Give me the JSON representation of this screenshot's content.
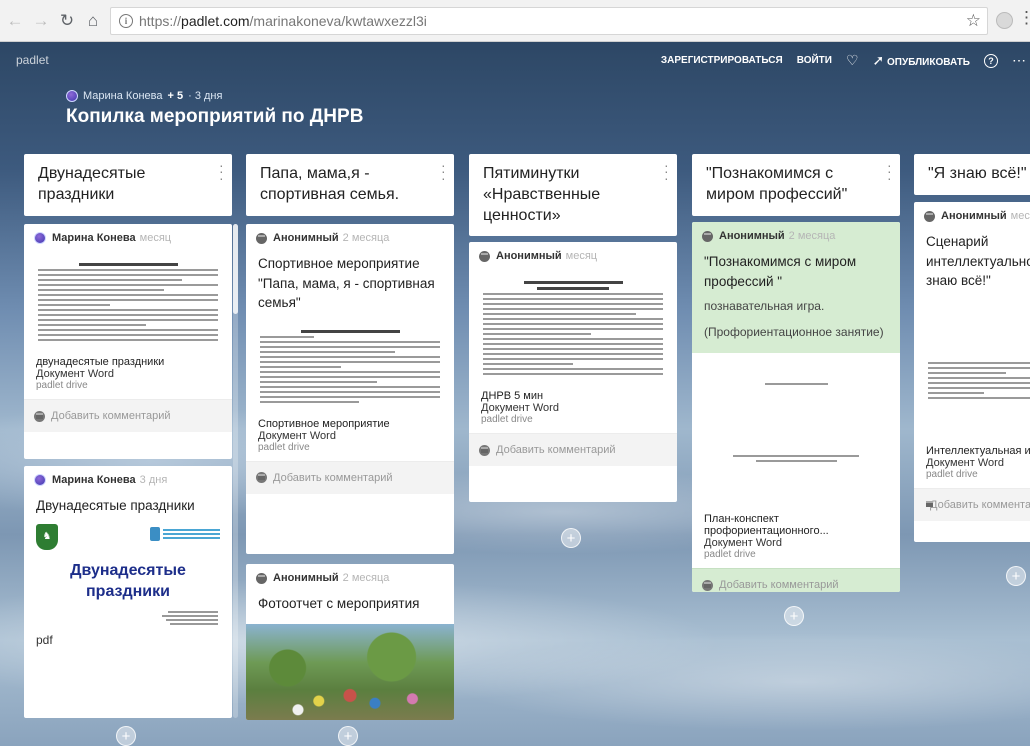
{
  "browser": {
    "url_scheme": "https://",
    "url_host": "padlet.com",
    "url_path": "/marinakoneva/kwtawxezzl3i"
  },
  "app": {
    "logo": "padlet",
    "actions": {
      "signup": "ЗАРЕГИСТРИРОВАТЬСЯ",
      "login": "ВОЙТИ",
      "publish": "ОПУБЛИКОВАТЬ"
    }
  },
  "board": {
    "author": "Марина Конева",
    "contributors": "+ 5",
    "age": "· 3 дня",
    "title": "Копилка мероприятий по ДНРВ"
  },
  "columns": [
    {
      "title": "Двунадесятые праздники",
      "cards": [
        {
          "author": "Марина Конева",
          "when": "месяц",
          "caption": "двунадесятые праздники",
          "type": "Документ Word",
          "source": "padlet drive",
          "comment": "Добавить комментарий"
        },
        {
          "author": "Марина Конева",
          "when": "3 дня",
          "title": "Двунадесятые праздники",
          "big_title": "Двунадесятые праздники",
          "type": "pdf"
        }
      ]
    },
    {
      "title": "Папа, мама,я - спортивная семья.",
      "cards": [
        {
          "author": "Анонимный",
          "when": "2 месяца",
          "title": "Спортивное мероприятие \"Папа, мама, я - спортивная семья\"",
          "caption": "Спортивное мероприятие",
          "type": "Документ Word",
          "source": "padlet drive",
          "comment": "Добавить комментарий"
        },
        {
          "author": "Анонимный",
          "when": "2 месяца",
          "title": "Фотоотчет с мероприятия"
        }
      ]
    },
    {
      "title": "Пятиминутки «Нравственные ценности»",
      "cards": [
        {
          "author": "Анонимный",
          "when": "месяц",
          "caption": "ДНРВ 5 мин",
          "type": "Документ Word",
          "source": "padlet drive",
          "comment": "Добавить комментарий"
        }
      ]
    },
    {
      "title": "\"Познакомимся с миром профессий\"",
      "cards": [
        {
          "author": "Анонимный",
          "when": "2 месяца",
          "title": "\"Познакомимся с миром профессий \"",
          "body1": "познавательная игра.",
          "body2": "(Профориентационное занятие)",
          "caption": "План-конспект профориентационного...",
          "type": "Документ Word",
          "source": "padlet drive",
          "comment": "Добавить комментарий"
        }
      ]
    },
    {
      "title": "\"Я знаю всё!\"",
      "cards": [
        {
          "author": "Анонимный",
          "when": "месяц",
          "title": "Сценарий интеллектуальной игры \"Я знаю всё!\"",
          "caption": "Интеллектуальная игра",
          "type": "Документ Word",
          "source": "padlet drive",
          "comment": "Добавить комментарий"
        }
      ]
    }
  ],
  "icons": {
    "back": "back-arrow-icon",
    "forward": "forward-arrow-icon",
    "reload": "reload-icon",
    "home": "home-icon",
    "info": "info-icon",
    "bookmark": "star-icon",
    "heart": "heart-icon",
    "share": "share-arrow-icon",
    "help": "help-icon",
    "more": "more-dots-icon",
    "add": "plus-icon"
  },
  "colors": {
    "card_green": "#d6ecd2",
    "title_blue": "#1d2e8a"
  }
}
